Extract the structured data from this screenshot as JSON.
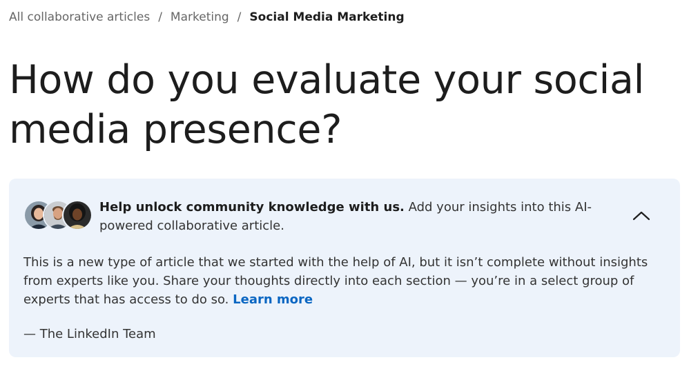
{
  "breadcrumb": {
    "items": [
      {
        "label": "All collaborative articles"
      },
      {
        "label": "Marketing"
      }
    ],
    "separator": "/",
    "current": "Social Media Marketing"
  },
  "article": {
    "title": "How do you evaluate your social media presence?"
  },
  "notice": {
    "headline_bold": "Help unlock community knowledge with us.",
    "headline_rest": " Add your insights into this AI-powered collaborative article.",
    "body": "This is a new type of article that we started with the help of AI, but it isn’t complete without insights from experts like you. Share your thoughts directly into each section — you’re in a select group of experts that has access to do so.",
    "learn_more": "Learn more",
    "signature": "— The LinkedIn Team",
    "collapse_icon": "chevron-up-icon",
    "colors": {
      "card_background": "#edf3fb",
      "link": "#0a66c2"
    }
  }
}
